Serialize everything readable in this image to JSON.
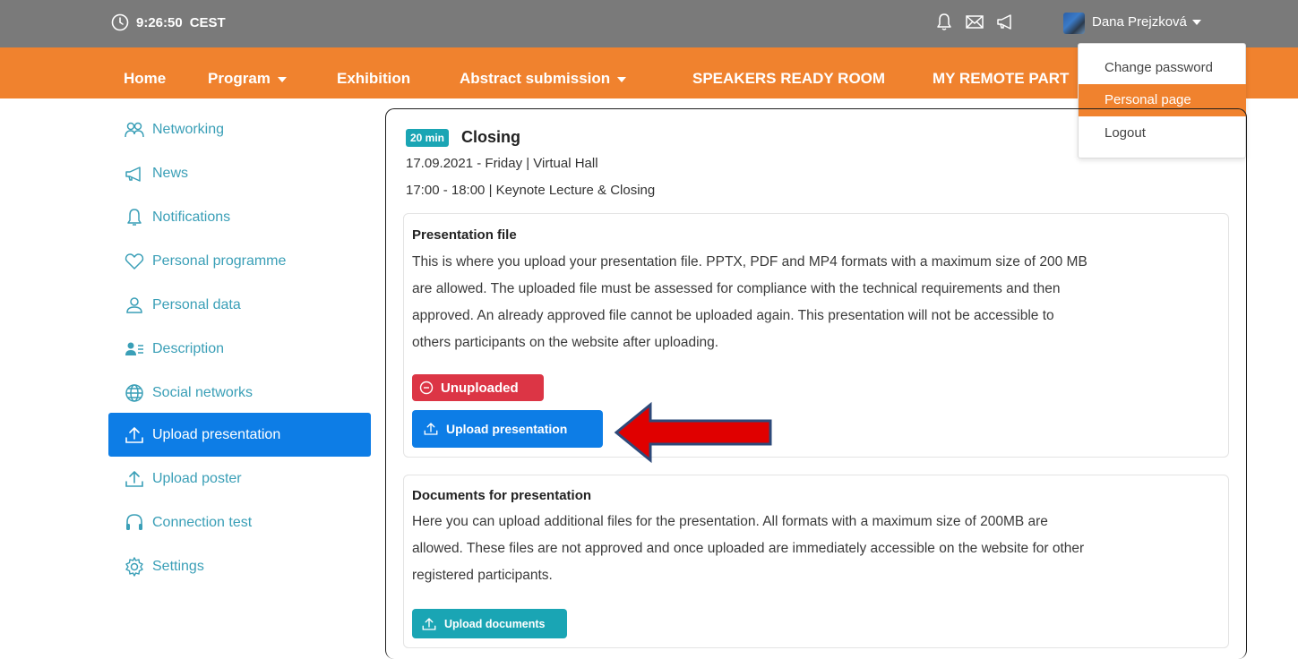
{
  "topbar": {
    "time": "9:26:50",
    "timezone": "CEST",
    "user_name": "Dana Prejzková"
  },
  "nav": {
    "items": [
      {
        "label": "Home",
        "dropdown": false
      },
      {
        "label": "Program",
        "dropdown": true
      },
      {
        "label": "Exhibition",
        "dropdown": false
      },
      {
        "label": "Abstract submission",
        "dropdown": true
      },
      {
        "label": "SPEAKERS READY ROOM",
        "dropdown": false
      },
      {
        "label": "MY REMOTE PART",
        "dropdown": false
      }
    ]
  },
  "user_menu": {
    "items": [
      {
        "label": "Change password",
        "active": false
      },
      {
        "label": "Personal page",
        "active": true
      },
      {
        "label": "Logout",
        "active": false
      }
    ]
  },
  "sidebar": {
    "items": [
      {
        "label": "Networking",
        "icon": "people-icon"
      },
      {
        "label": "News",
        "icon": "megaphone-icon"
      },
      {
        "label": "Notifications",
        "icon": "bell-icon"
      },
      {
        "label": "Personal programme",
        "icon": "heart-icon"
      },
      {
        "label": "Personal data",
        "icon": "user-icon"
      },
      {
        "label": "Description",
        "icon": "user-list-icon"
      },
      {
        "label": "Social networks",
        "icon": "globe-icon"
      },
      {
        "label": "Upload presentation",
        "icon": "upload-icon",
        "active": true
      },
      {
        "label": "Upload poster",
        "icon": "upload-icon"
      },
      {
        "label": "Connection test",
        "icon": "headset-icon"
      },
      {
        "label": "Settings",
        "icon": "gear-icon"
      }
    ]
  },
  "session": {
    "duration": "20 min",
    "title": "Closing",
    "date_line": "17.09.2021 - Friday | Virtual Hall",
    "time_line": "17:00 - 18:00 | Keynote Lecture & Closing"
  },
  "presentation_file": {
    "title": "Presentation file",
    "lines": [
      "This is where you upload your presentation file. PPTX, PDF and MP4 formats with a maximum size of 200 MB",
      "are allowed. The uploaded file must be assessed for compliance with the technical requirements and then",
      "approved. An already approved file cannot be uploaded again. This presentation will not be accessible to",
      "others participants on the website after uploading."
    ],
    "status": "Unuploaded",
    "button": "Upload presentation"
  },
  "documents": {
    "title": "Documents for presentation",
    "lines": [
      "Here you can upload additional files for the presentation. All formats with a maximum size of 200MB are",
      "allowed. These files are not approved and once uploaded are immediately accessible on the website for other",
      "registered participants."
    ],
    "button": "Upload documents"
  },
  "colors": {
    "topbar": "#7a7a7a",
    "nav": "#f0822e",
    "primary": "#0d7de6",
    "info": "#1aa5b4",
    "danger": "#dc3545",
    "sidebar_text": "#3a9fb7",
    "arrow": "#e00000"
  }
}
